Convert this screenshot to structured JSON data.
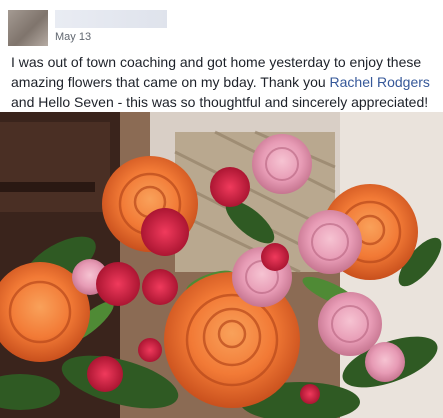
{
  "post": {
    "date": "May 13",
    "text_before": "I was out of town coaching and got home yesterday to enjoy these amazing flowers that came on my bday. Thank you ",
    "mention": "Rachel Rodgers",
    "text_after": " and Hello Seven - this was so thoughtful and sincerely appreciated!",
    "emoji": "❤️",
    "emoji_icon": "heart-icon"
  },
  "colors": {
    "text": "#1d2129",
    "mention": "#365899",
    "date": "#616770",
    "heart": "#e8212f"
  }
}
